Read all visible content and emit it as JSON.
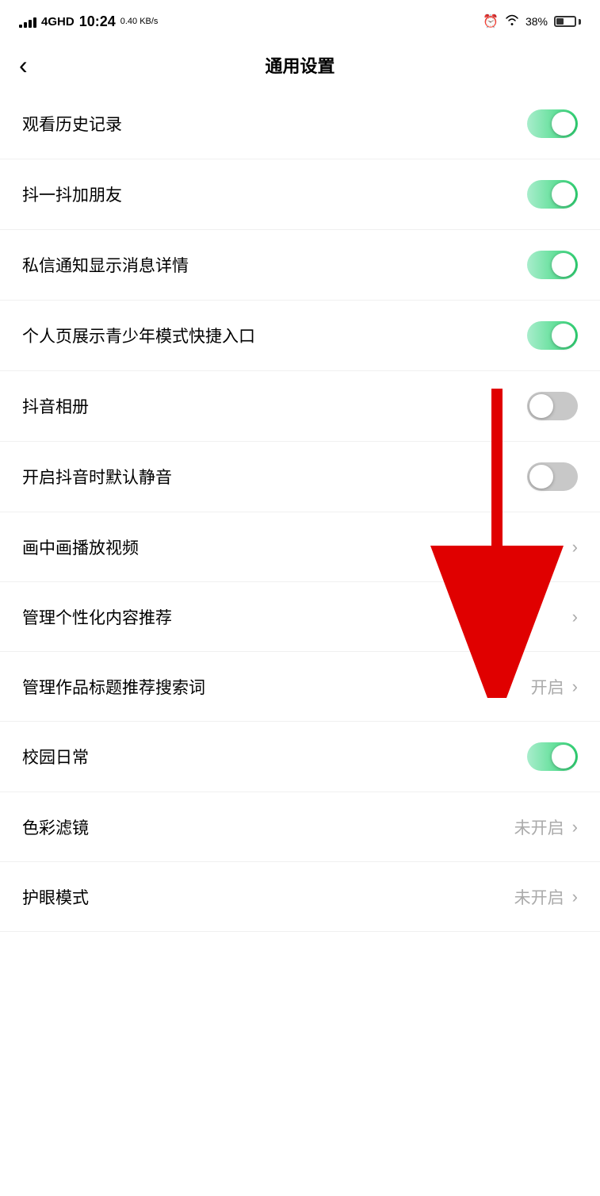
{
  "statusBar": {
    "networkType": "4GHD",
    "time": "10:24",
    "speed": "0.40 KB/s",
    "battery": "38%"
  },
  "header": {
    "backLabel": "‹",
    "title": "通用设置"
  },
  "settings": [
    {
      "id": "watch-history",
      "label": "观看历史记录",
      "type": "toggle",
      "value": true,
      "statusText": "",
      "hasArrow": false
    },
    {
      "id": "shake-add-friend",
      "label": "抖一抖加朋友",
      "type": "toggle",
      "value": true,
      "statusText": "",
      "hasArrow": false
    },
    {
      "id": "dm-notification-detail",
      "label": "私信通知显示消息详情",
      "type": "toggle",
      "value": true,
      "statusText": "",
      "hasArrow": false
    },
    {
      "id": "youth-mode-shortcut",
      "label": "个人页展示青少年模式快捷入口",
      "type": "toggle",
      "value": true,
      "statusText": "",
      "hasArrow": false
    },
    {
      "id": "douyin-album",
      "label": "抖音相册",
      "type": "toggle",
      "value": false,
      "statusText": "",
      "hasArrow": false
    },
    {
      "id": "default-mute",
      "label": "开启抖音时默认静音",
      "type": "toggle",
      "value": false,
      "statusText": "",
      "hasArrow": false
    },
    {
      "id": "pip-video",
      "label": "画中画播放视频",
      "type": "arrow",
      "value": null,
      "statusText": "",
      "hasArrow": true
    },
    {
      "id": "personalized-content",
      "label": "管理个性化内容推荐",
      "type": "arrow",
      "value": null,
      "statusText": "",
      "hasArrow": true
    },
    {
      "id": "title-recommend",
      "label": "管理作品标题推荐搜索词",
      "type": "arrow-with-status",
      "value": null,
      "statusText": "开启",
      "hasArrow": true
    },
    {
      "id": "campus-daily",
      "label": "校园日常",
      "type": "toggle",
      "value": true,
      "statusText": "",
      "hasArrow": false
    },
    {
      "id": "color-filter",
      "label": "色彩滤镜",
      "type": "arrow-with-status",
      "value": null,
      "statusText": "未开启",
      "hasArrow": true
    },
    {
      "id": "eye-care",
      "label": "护眼模式",
      "type": "arrow-with-status",
      "value": null,
      "statusText": "未开启",
      "hasArrow": true
    }
  ],
  "icons": {
    "back": "‹",
    "chevron": "›",
    "alarm": "⏰",
    "wifi": "📶"
  }
}
